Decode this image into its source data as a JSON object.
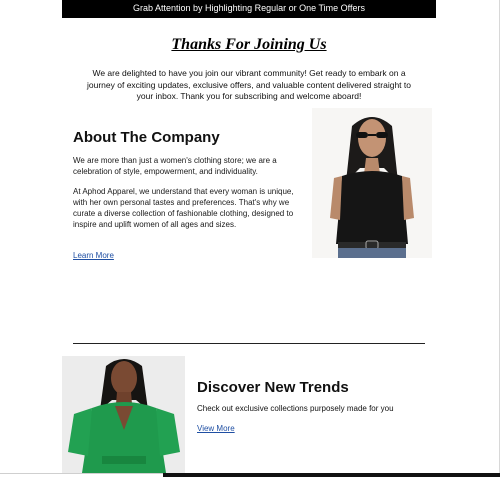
{
  "topbar": {
    "text": "Grab Attention by Highlighting Regular or One Time Offers"
  },
  "header": {
    "title": "Thanks For Joining Us",
    "intro": "We are delighted to have you join our vibrant community! Get ready to embark on a journey of exciting updates, exclusive offers, and valuable content delivered straight to your inbox. Thank you for subscribing and welcome aboard!"
  },
  "about": {
    "title": "About The Company",
    "paragraph1": "We are more than just a women's clothing store; we are a celebration of style, empowerment, and individuality.",
    "paragraph2": "At Aphod Apparel, we understand that every woman is unique, with her own personal tastes and preferences. That's why we curate a diverse collection of fashionable clothing, designed to inspire and uplift women of all ages and sizes.",
    "link": "Learn More"
  },
  "trends": {
    "title": "Discover New Trends",
    "text": "Check out exclusive collections purposely made for you",
    "link": "View More"
  },
  "colors": {
    "topbar": "#000000",
    "link": "#1f4fa3",
    "model_top_green": "#1f9a4d"
  }
}
